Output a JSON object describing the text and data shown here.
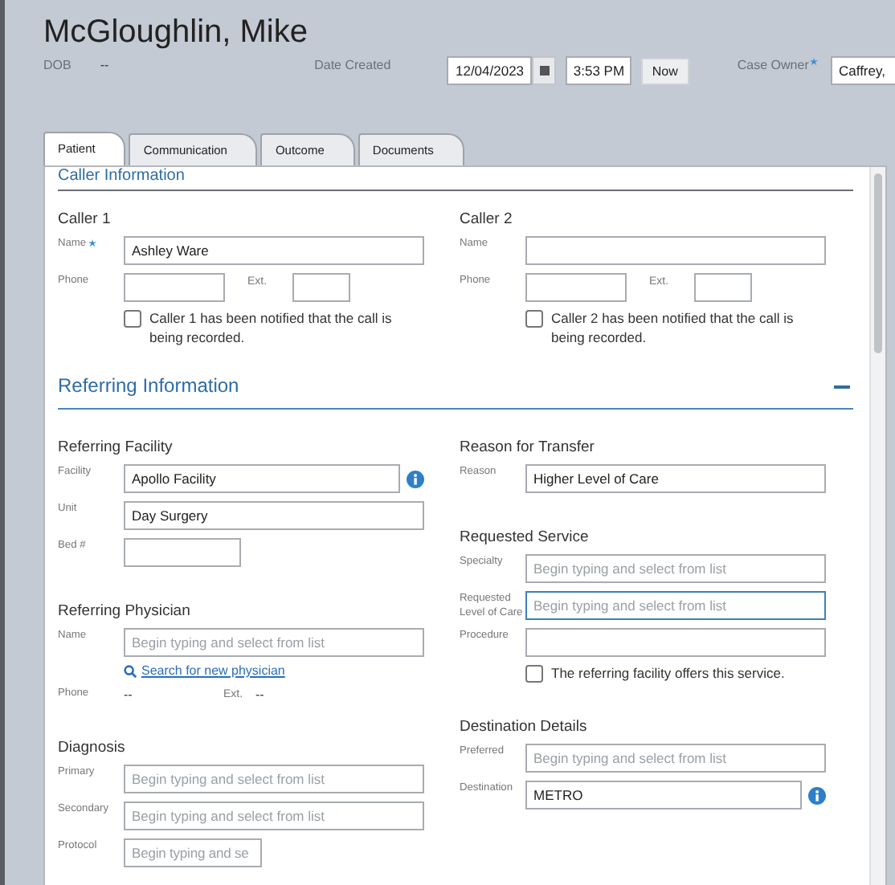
{
  "header": {
    "name": "McGloughlin, Mike",
    "dob_label": "DOB",
    "dob_value": "--",
    "date_created_label": "Date Created",
    "date": "12/04/2023",
    "time": "3:53 PM",
    "now_button": "Now",
    "case_owner_label": "Case Owner",
    "case_owner_required": true,
    "case_owner": "Caffrey,"
  },
  "tabs": [
    {
      "label": "Patient",
      "selected": true
    },
    {
      "label": "Communication",
      "selected": false
    },
    {
      "label": "Outcome",
      "selected": false
    },
    {
      "label": "Documents",
      "selected": false
    }
  ],
  "caller_information": {
    "title": "Caller Information",
    "callers": [
      {
        "title": "Caller 1",
        "fields": [
          {
            "kind": "input",
            "label": "Name",
            "required": true,
            "value": "Ashley Ware"
          },
          {
            "kind": "phone",
            "label": "Phone",
            "ext_label": "Ext."
          },
          {
            "kind": "checkbox",
            "text": "Caller 1 has been notified that the call is being recorded.",
            "checked": false
          }
        ]
      },
      {
        "title": "Caller 2",
        "fields": [
          {
            "kind": "input",
            "label": "Name",
            "required": false
          },
          {
            "kind": "phone",
            "label": "Phone",
            "ext_label": "Ext."
          },
          {
            "kind": "checkbox",
            "text": "Caller 2 has been notified that the call is being recorded.",
            "checked": false
          }
        ]
      }
    ]
  },
  "referring_information": {
    "title": "Referring Information",
    "expanded": true,
    "columns": [
      [
        {
          "title": "Referring Facility",
          "fields": [
            {
              "kind": "input",
              "label": "Facility",
              "value": "Apollo Facility",
              "info": true
            },
            {
              "kind": "input",
              "label": "Unit",
              "value": "Day Surgery"
            },
            {
              "kind": "short_input",
              "label": "Bed #"
            }
          ]
        },
        {
          "title": "Referring Physician",
          "fields": [
            {
              "kind": "input",
              "label": "Name",
              "placeholder": "Begin typing and select from list"
            },
            {
              "kind": "link",
              "text": "Search for new physician"
            },
            {
              "kind": "readonly",
              "label": "Phone",
              "value": "--",
              "ext_label": "Ext.",
              "ext_value": "--"
            }
          ]
        },
        {
          "title": "Diagnosis",
          "fields": [
            {
              "kind": "input",
              "label": "Primary",
              "placeholder": "Begin typing and select from list"
            },
            {
              "kind": "input",
              "label": "Secondary",
              "placeholder": "Begin typing and select from list"
            },
            {
              "kind": "short_input",
              "label": "Protocol",
              "placeholder": "Begin typing and se"
            }
          ]
        }
      ],
      [
        {
          "title": "Reason for Transfer",
          "fields": [
            {
              "kind": "input",
              "label": "Reason",
              "value": "Higher Level of Care"
            }
          ]
        },
        {
          "title": "Requested Service",
          "fields": [
            {
              "kind": "input",
              "label": "Specialty",
              "placeholder": "Begin typing and select from list"
            },
            {
              "kind": "input",
              "label": "Requested Level of Care",
              "placeholder": "Begin typing and select from list",
              "focused": true
            },
            {
              "kind": "input",
              "label": "Procedure"
            },
            {
              "kind": "checkbox",
              "text": "The referring facility offers this service.",
              "checked": false
            }
          ]
        },
        {
          "title": "Destination Details",
          "fields": [
            {
              "kind": "input",
              "label": "Preferred",
              "placeholder": "Begin typing and select from list"
            },
            {
              "kind": "input",
              "label": "Destination",
              "value": "METRO",
              "info": true
            }
          ]
        }
      ]
    ]
  }
}
